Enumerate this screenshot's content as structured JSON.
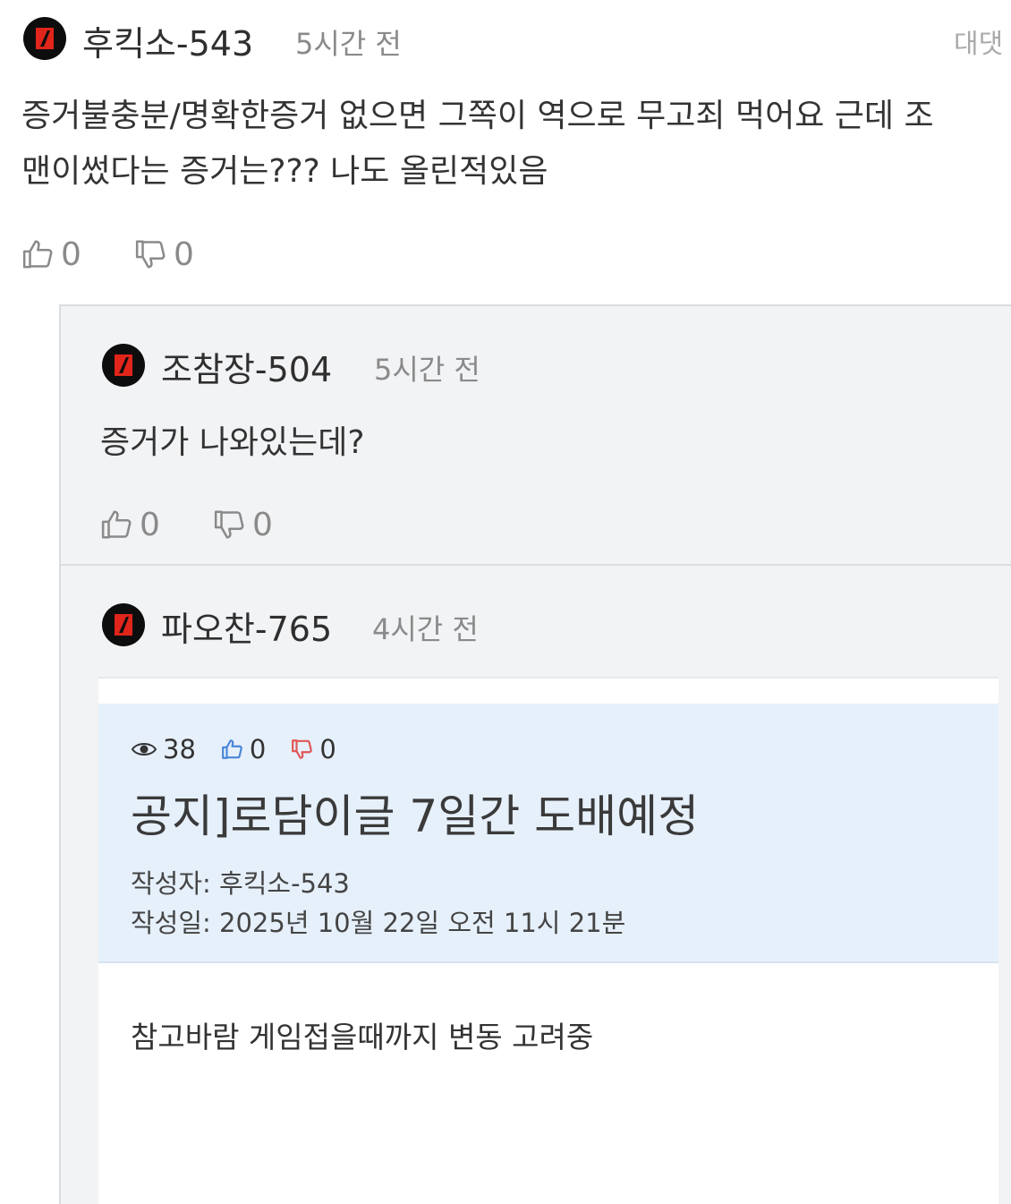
{
  "comments": [
    {
      "author": "후킥소-543",
      "time": "5시간 전",
      "reply_label": "대댓",
      "text_lines": [
        "증거불충분/명확한증거 없으면 그쪽이 역으로 무고죄 먹어요 근데 조",
        "맨이썼다는 증거는??? 나도 올린적있음"
      ],
      "likes": "0",
      "dislikes": "0"
    },
    {
      "author": "조참장-504",
      "time": "5시간 전",
      "text_lines": [
        "증거가 나와있는데?"
      ],
      "likes": "0",
      "dislikes": "0"
    },
    {
      "author": "파오찬-765",
      "time": "4시간 전"
    }
  ],
  "embedded_post": {
    "views": "38",
    "likes": "0",
    "dislikes": "0",
    "title": "공지]로담이글 7일간 도배예정",
    "author_line": "작성자: 후킥소-543",
    "date_line": "작성일: 2025년 10월 22일 오전 11시 21분",
    "body": "참고바람 게임접을때까지 변동 고려중"
  },
  "colors": {
    "avatar_bg": "#0d0d0d",
    "avatar_mark": "#e0251b",
    "reply_bg": "#f2f3f5",
    "card_header_bg": "#e6f0fb",
    "like_icon": "#4a86d8",
    "dislike_icon": "#e05555"
  }
}
